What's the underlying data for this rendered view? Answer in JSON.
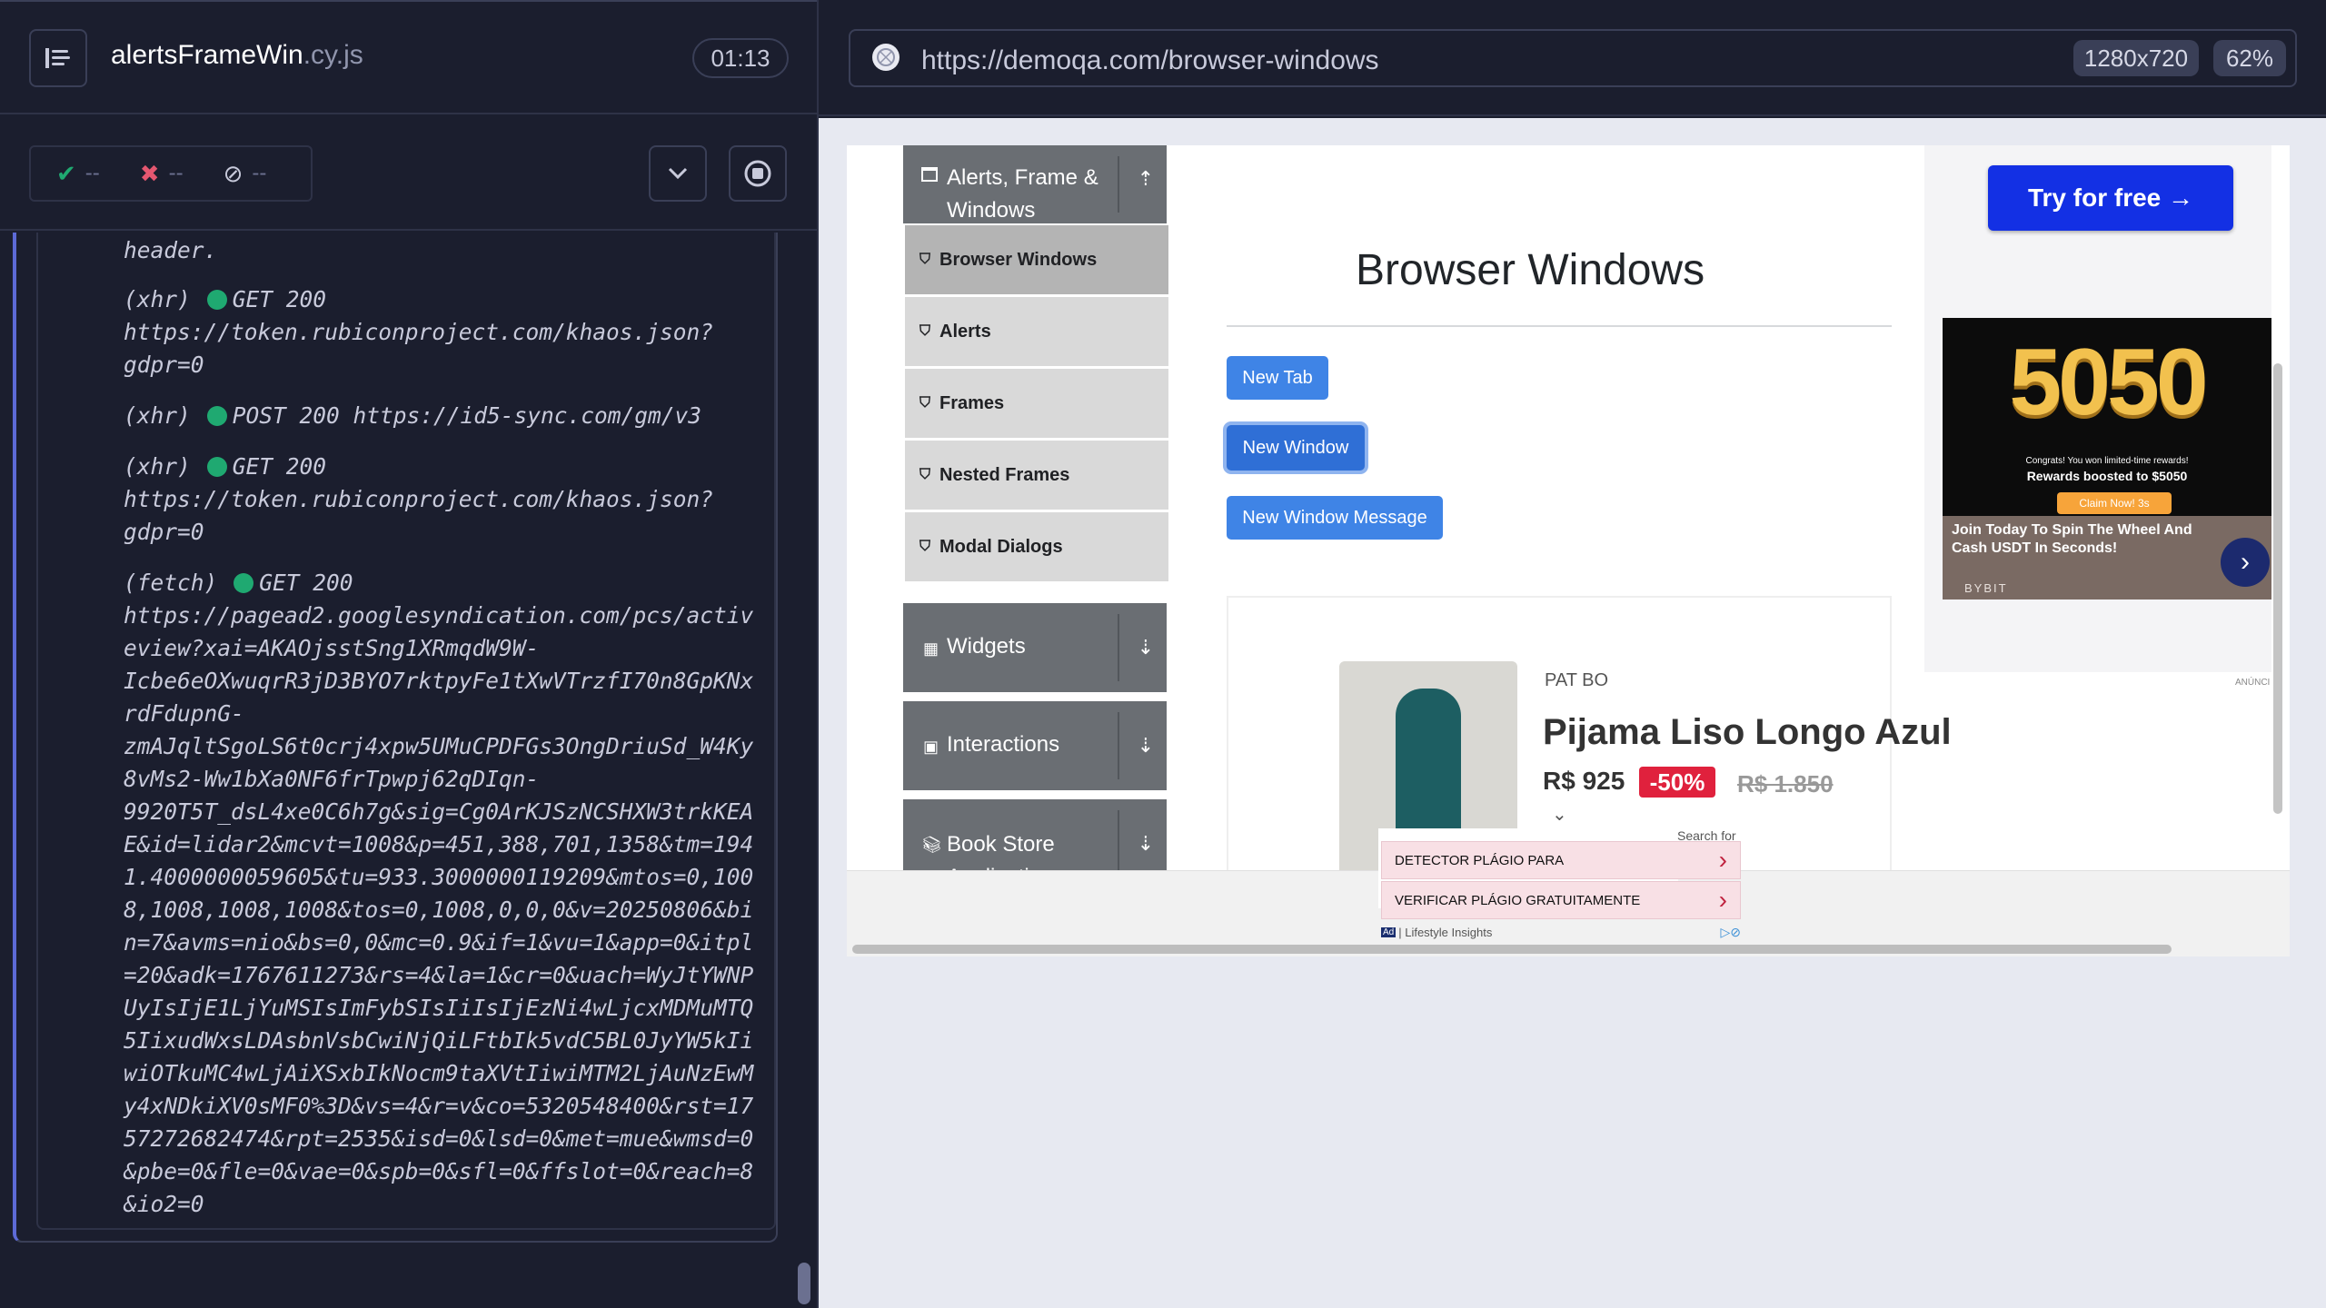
{
  "reporter": {
    "spec_name": "alertsFrameWin",
    "spec_ext": ".cy.js",
    "timer": "01:13",
    "stats": {
      "passed": "--",
      "failed": "--",
      "pending": "--"
    }
  },
  "log": [
    {
      "lines": [
        "header."
      ]
    },
    {
      "kind": "(xhr)",
      "method_status": "GET 200",
      "lines": [
        "https://token.rubiconproject.com/khaos.json?",
        "gdpr=0"
      ]
    },
    {
      "kind": "(xhr)",
      "method_status": "POST 200 https://id5-sync.com/gm/v3",
      "lines": []
    },
    {
      "kind": "(xhr)",
      "method_status": "GET 200",
      "lines": [
        "https://token.rubiconproject.com/khaos.json?",
        "gdpr=0"
      ]
    },
    {
      "kind": "(fetch)",
      "method_status": "GET 200",
      "lines": [
        "https://pagead2.googlesyndication.com/pcs/activ",
        "eview?xai=AKAOjsstSng1XRmqdW9W-",
        "Icbe6eOXwuqrR3jD3BYO7rktpyFe1tXwVTrzfI70n8GpKNx",
        "rdFdupnG-",
        "zmAJqltSgoLS6t0crj4xpw5UMuCPDFGs3OngDriuSd_W4Ky",
        "8vMs2-Ww1bXa0NF6frTpwpj62qDIqn-",
        "9920T5T_dsL4xe0C6h7g&sig=Cg0ArKJSzNCSHXW3trkKEA",
        "E&id=lidar2&mcvt=1008&p=451,388,701,1358&tm=194",
        "1.4000000059605&tu=933.3000000119209&mtos=0,100",
        "8,1008,1008,1008&tos=0,1008,0,0,0&v=20250806&bi",
        "n=7&avms=nio&bs=0,0&mc=0.9&if=1&vu=1&app=0&itpl",
        "=20&adk=1767611273&rs=4&la=1&cr=0&uach=WyJtYWNP",
        "UyIsIjE1LjYuMSIsImFybSIsIiIsIjEzNi4wLjcxMDMuMTQ",
        "5IixudWxsLDAsbnVsbCwiNjQiLFtbIk5vdC5BL0JyYW5kIi",
        "wiOTkuMC4wLjAiXSxbIkNocm9taXVtIiwiMTM2LjAuNzEwM",
        "y4xNDkiXV0sMF0%3D&vs=4&r=v&co=5320548400&rst=17",
        "57272682474&rpt=2535&isd=0&lsd=0&met=mue&wmsd=0",
        "&pbe=0&fle=0&vae=0&spb=0&sfl=0&ffslot=0&reach=8",
        "&io2=0"
      ]
    }
  ],
  "browser": {
    "url": "https://demoqa.com/browser-windows",
    "viewport": "1280x720",
    "zoom": "62%"
  },
  "demoqa": {
    "nav_group_alerts": "Alerts, Frame & Windows",
    "nav_items": [
      "Browser Windows",
      "Alerts",
      "Frames",
      "Nested Frames",
      "Modal Dialogs"
    ],
    "nav_group_widgets": "Widgets",
    "nav_group_interactions": "Interactions",
    "nav_group_bookstore": "Book Store Application",
    "page_title": "Browser Windows",
    "buttons": [
      "New Tab",
      "New Window",
      "New Window Message"
    ]
  },
  "ads": {
    "cta": "Try for free →",
    "bybit_big": "5050",
    "bybit_small1": "Congrats! You won limited-time rewards!",
    "bybit_small2": "Rewards boosted to $5050",
    "bybit_claim": "Claim Now! 3s",
    "bybit_text": "Join Today To Spin The Wheel And Cash USDT In Seconds!",
    "bybit_brand": "BYBIT",
    "anuncio": "ANÚNCI",
    "brand_logo": "PAT BO",
    "product_title": "Pijama Liso Longo Azul",
    "price": "R$ 925",
    "discount": "-50%",
    "old_price": "R$ 1.850",
    "search_for": "Search for",
    "search_items": [
      "DETECTOR PLÁGIO PARA",
      "VERIFICAR PLÁGIO GRATUITAMENTE"
    ],
    "footer_label": "| Lifestyle Insights",
    "ad_badge": "Ad"
  }
}
